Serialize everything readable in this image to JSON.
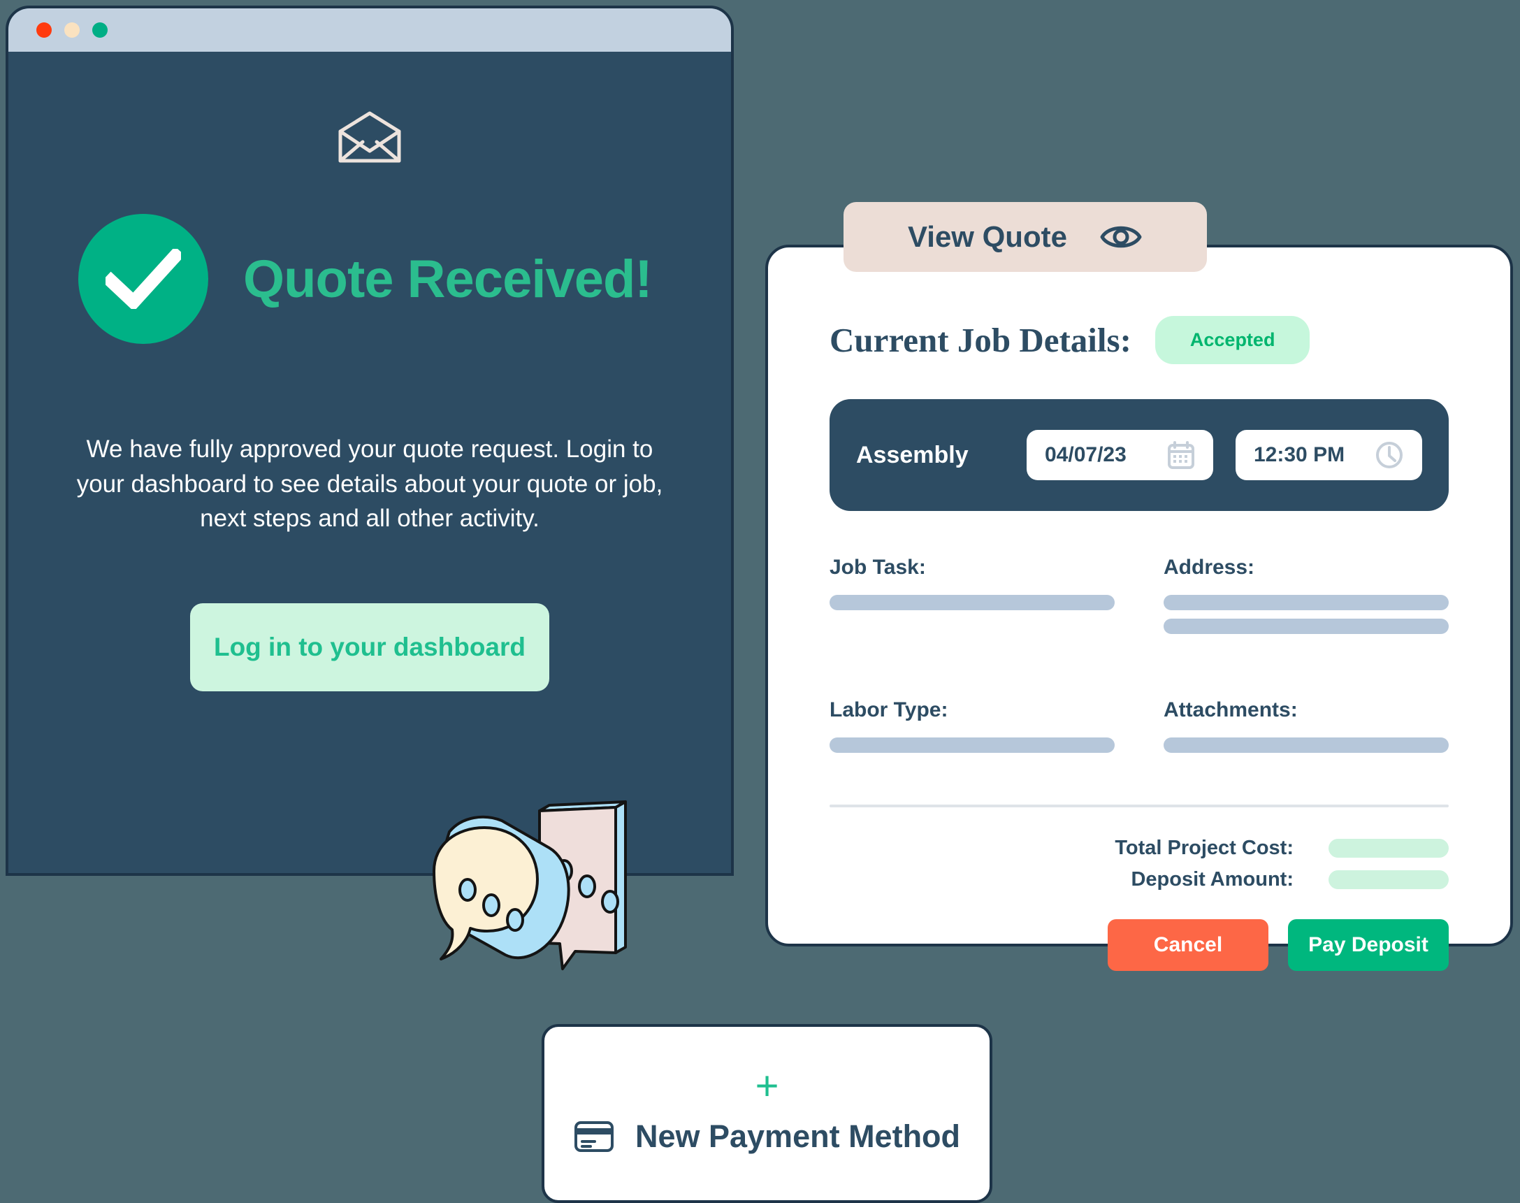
{
  "window": {
    "title_dots": [
      "close-dot",
      "minimize-dot",
      "maximize-dot"
    ]
  },
  "email_panel": {
    "envelope_icon": "open-envelope-icon",
    "check_icon": "check-mark-icon",
    "heading": "Quote Received!",
    "body": "We have fully approved your quote request. Login to your dashboard to see details about your quote or job, next steps and all other activity.",
    "cta_label": "Log in to your dashboard",
    "illustration": "speech-bubbles-illustration"
  },
  "quote": {
    "tab_label": "View Quote",
    "tab_icon": "eye-icon",
    "details_title": "Current Job Details:",
    "status": "Accepted",
    "assembly": {
      "label": "Assembly",
      "date": "04/07/23",
      "date_icon": "calendar-icon",
      "time": "12:30 PM",
      "time_icon": "clock-icon"
    },
    "fields": [
      {
        "label": "Job Task:",
        "bars": 1
      },
      {
        "label": "Address:",
        "bars": 2
      },
      {
        "label": "Labor Type:",
        "bars": 1
      },
      {
        "label": "Attachments:",
        "bars": 1
      }
    ],
    "costs": [
      {
        "label": "Total Project Cost:"
      },
      {
        "label": "Deposit Amount:"
      }
    ],
    "cancel_label": "Cancel",
    "pay_label": "Pay Deposit"
  },
  "payment": {
    "plus_icon": "plus-icon",
    "card_icon": "credit-card-icon",
    "label": "New Payment Method"
  },
  "colors": {
    "background": "#4d6a73",
    "panel_navy": "#2d4c63",
    "accent_green": "#00b185",
    "accent_mint": "#cdf5df",
    "tab_blush": "#ecddd6",
    "cancel_red": "#fd6746",
    "pay_green": "#00b77e",
    "bar_gray": "#b6c7da"
  }
}
